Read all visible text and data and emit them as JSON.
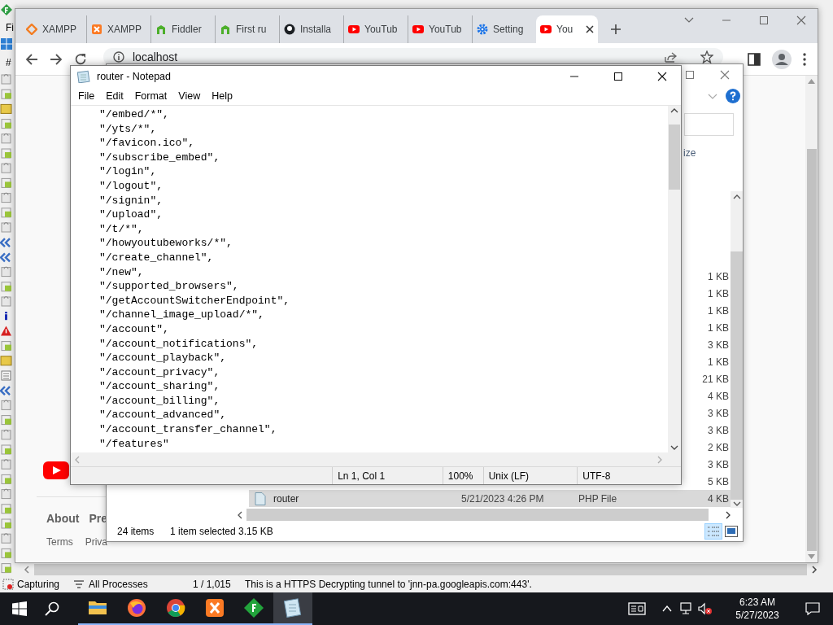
{
  "fiddler": {
    "menu_fragment": "Fi",
    "column_header": "#",
    "status_bar": {
      "capture": "Capturing",
      "process_filter": "All Processes",
      "session_count": "1 / 1,015",
      "message": "This is a HTTPS Decrypting tunnel to 'jnn-pa.googleapis.com:443'."
    }
  },
  "browser": {
    "tabs": [
      {
        "label": "XAMPP",
        "kind": "xampp-outline",
        "selected": false
      },
      {
        "label": "XAMPP",
        "kind": "xampp",
        "selected": false
      },
      {
        "label": "Fiddler",
        "kind": "fiddler",
        "selected": false
      },
      {
        "label": "First ru",
        "kind": "fiddler",
        "selected": false
      },
      {
        "label": "Installa",
        "kind": "github",
        "selected": false
      },
      {
        "label": "YouTub",
        "kind": "youtube",
        "selected": false
      },
      {
        "label": "YouTub",
        "kind": "youtube",
        "selected": false
      },
      {
        "label": "Setting",
        "kind": "settings",
        "selected": false
      },
      {
        "label": "You",
        "kind": "youtube",
        "selected": true
      }
    ],
    "address": "localhost",
    "page": {
      "footer_links": [
        "About",
        "Pre"
      ],
      "footer_small": [
        "Terms",
        "Priva"
      ]
    }
  },
  "explorer": {
    "size_header": "ize",
    "sizes": [
      "1 KB",
      "1 KB",
      "1 KB",
      "1 KB",
      "3 KB",
      "1 KB",
      "21 KB",
      "4 KB",
      "3 KB",
      "3 KB",
      "2 KB",
      "3 KB",
      "5 KB"
    ],
    "rows": [
      {
        "name": "router",
        "date": "5/21/2023 4:26 PM",
        "type": "PHP File",
        "size": "4 KB",
        "selected": true
      }
    ],
    "item_count": "24 items",
    "selection": "1 item selected",
    "selection_size": "3.15 KB"
  },
  "notepad": {
    "title": "router - Notepad",
    "menu": [
      "File",
      "Edit",
      "Format",
      "View",
      "Help"
    ],
    "lines": [
      "\"/embed/*\",",
      "\"/yts/*\",",
      "\"/favicon.ico\",",
      "\"/subscribe_embed\",",
      "\"/login\",",
      "\"/logout\",",
      "\"/signin\",",
      "\"/upload\",",
      "\"/t/*\",",
      "\"/howyoutubeworks/*\",",
      "\"/create_channel\",",
      "\"/new\",",
      "\"/supported_browsers\",",
      "\"/getAccountSwitcherEndpoint\",",
      "\"/channel_image_upload/*\",",
      "\"/account\",",
      "\"/account_notifications\",",
      "\"/account_playback\",",
      "\"/account_privacy\",",
      "\"/account_sharing\",",
      "\"/account_billing\",",
      "\"/account_advanced\",",
      "\"/account_transfer_channel\",",
      "\"/features\""
    ],
    "status": {
      "position": "Ln 1, Col 1",
      "zoom": "100%",
      "line_ending": "Unix (LF)",
      "encoding": "UTF-8"
    }
  },
  "taskbar": {
    "apps": [
      {
        "kind": "files",
        "selected": false
      },
      {
        "kind": "firefox",
        "selected": false
      },
      {
        "kind": "chrome",
        "selected": false
      },
      {
        "kind": "xampp",
        "selected": false
      },
      {
        "kind": "fiddler",
        "selected": false
      },
      {
        "kind": "notepad",
        "selected": true
      }
    ],
    "time": "6:23 AM",
    "date": "5/27/2023"
  }
}
